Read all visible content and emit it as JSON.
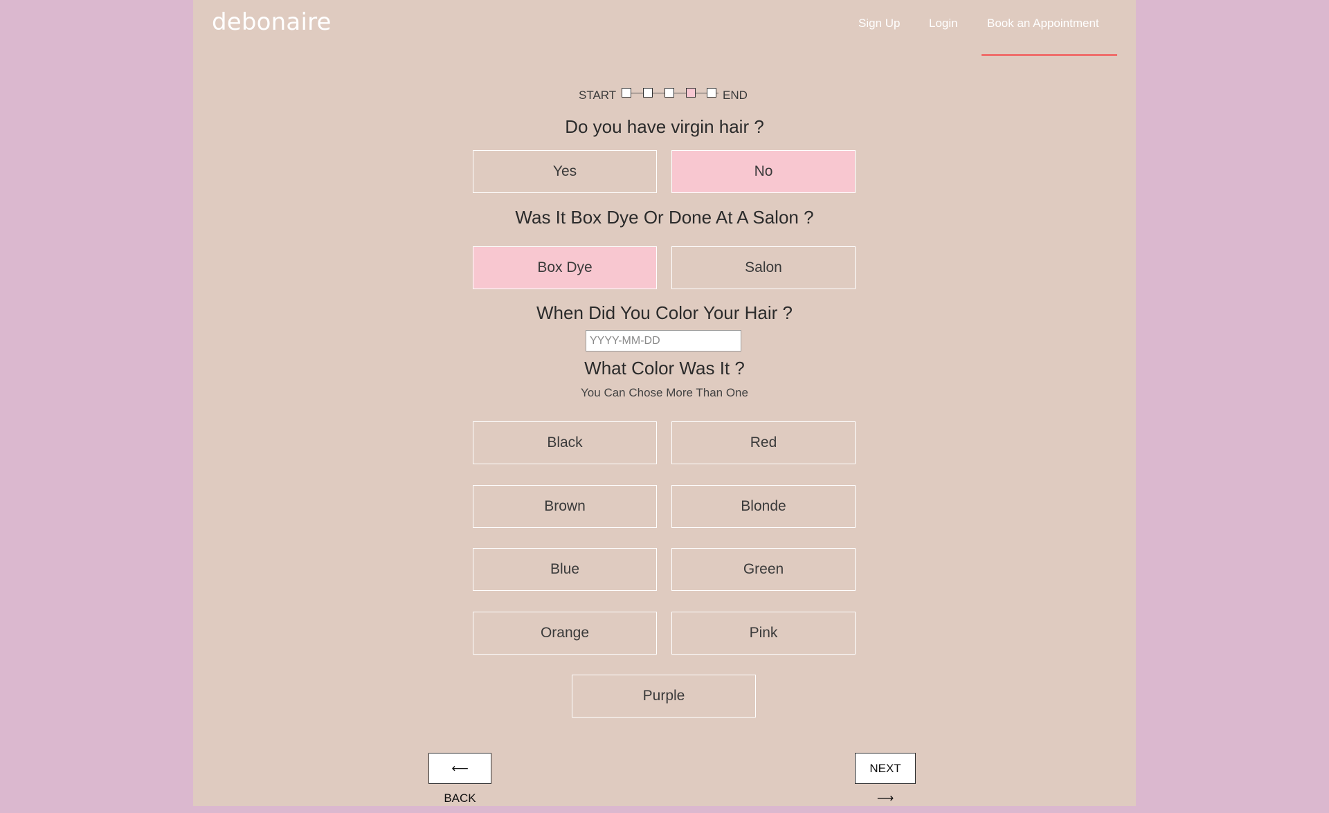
{
  "header": {
    "brand": "debonaire",
    "nav": {
      "signup": "Sign Up",
      "login": "Login",
      "book": "Book an Appointment"
    }
  },
  "progress": {
    "start_label": "START",
    "end_label": "END",
    "steps_total": 5,
    "current_step": 4
  },
  "questions": {
    "virgin_hair": {
      "title": "Do you have virgin hair ?",
      "options": [
        "Yes",
        "No"
      ],
      "selected": "No"
    },
    "dye_type": {
      "title": "Was It Box Dye Or Done At A Salon ?",
      "options": [
        "Box Dye",
        "Salon"
      ],
      "selected": "Box Dye"
    },
    "color_date": {
      "title": "When Did You Color Your Hair ?",
      "placeholder": "YYYY-MM-DD",
      "value": ""
    },
    "color": {
      "title": "What Color Was It ?",
      "subtitle": "You Can Chose More Than One",
      "options": [
        "Black",
        "Red",
        "Brown",
        "Blonde",
        "Blue",
        "Green",
        "Orange",
        "Pink",
        "Purple"
      ],
      "selected": []
    }
  },
  "footer": {
    "back_label": "⟵ BACK",
    "next_label": "NEXT ⟶"
  },
  "colors": {
    "page_bg": "#dbb8cf",
    "panel_bg": "#dfcbc0",
    "selected_bg": "#f8c7d0",
    "nav_underline": "#ef6f6c"
  }
}
